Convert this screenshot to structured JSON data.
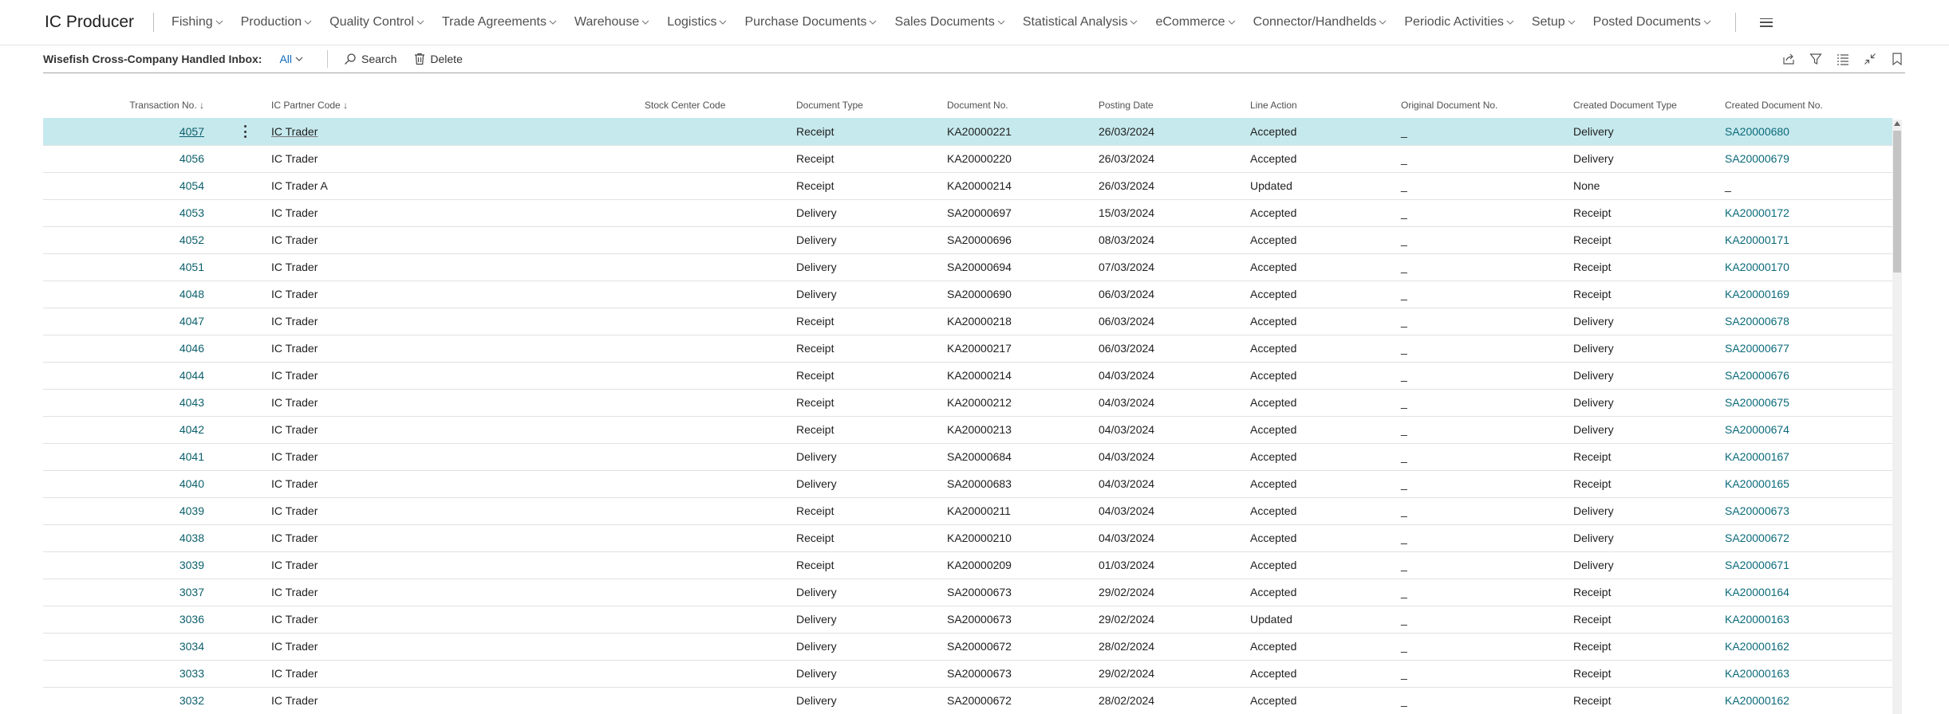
{
  "app_title": "IC Producer",
  "nav": [
    {
      "label": "Fishing"
    },
    {
      "label": "Production"
    },
    {
      "label": "Quality Control"
    },
    {
      "label": "Trade Agreements"
    },
    {
      "label": "Warehouse"
    },
    {
      "label": "Logistics"
    },
    {
      "label": "Purchase Documents"
    },
    {
      "label": "Sales Documents"
    },
    {
      "label": "Statistical Analysis"
    },
    {
      "label": "eCommerce"
    },
    {
      "label": "Connector/Handhelds"
    },
    {
      "label": "Periodic Activities"
    },
    {
      "label": "Setup"
    },
    {
      "label": "Posted Documents"
    }
  ],
  "page": {
    "caption": "Wisefish Cross-Company Handled Inbox:",
    "filter": "All",
    "actions": {
      "search": "Search",
      "delete": "Delete"
    }
  },
  "columns": [
    {
      "label": "Transaction No.",
      "sort": "↓"
    },
    {
      "label": "IC Partner Code",
      "sort": "↓"
    },
    {
      "label": "Stock Center Code"
    },
    {
      "label": "Document Type"
    },
    {
      "label": "Document No."
    },
    {
      "label": "Posting Date"
    },
    {
      "label": "Line Action"
    },
    {
      "label": "Original Document No."
    },
    {
      "label": "Created Document Type"
    },
    {
      "label": "Created Document No."
    }
  ],
  "rows": [
    {
      "tx": "4057",
      "partner": "IC Trader",
      "stock": "",
      "doctype": "Receipt",
      "docno": "KA20000221",
      "date": "26/03/2024",
      "action": "Accepted",
      "orig": "_",
      "ctype": "Delivery",
      "cno": "SA20000680"
    },
    {
      "tx": "4056",
      "partner": "IC Trader",
      "stock": "",
      "doctype": "Receipt",
      "docno": "KA20000220",
      "date": "26/03/2024",
      "action": "Accepted",
      "orig": "_",
      "ctype": "Delivery",
      "cno": "SA20000679"
    },
    {
      "tx": "4054",
      "partner": "IC Trader A",
      "stock": "",
      "doctype": "Receipt",
      "docno": "KA20000214",
      "date": "26/03/2024",
      "action": "Updated",
      "orig": "_",
      "ctype": "None",
      "cno": "_"
    },
    {
      "tx": "4053",
      "partner": "IC Trader",
      "stock": "",
      "doctype": "Delivery",
      "docno": "SA20000697",
      "date": "15/03/2024",
      "action": "Accepted",
      "orig": "_",
      "ctype": "Receipt",
      "cno": "KA20000172"
    },
    {
      "tx": "4052",
      "partner": "IC Trader",
      "stock": "",
      "doctype": "Delivery",
      "docno": "SA20000696",
      "date": "08/03/2024",
      "action": "Accepted",
      "orig": "_",
      "ctype": "Receipt",
      "cno": "KA20000171"
    },
    {
      "tx": "4051",
      "partner": "IC Trader",
      "stock": "",
      "doctype": "Delivery",
      "docno": "SA20000694",
      "date": "07/03/2024",
      "action": "Accepted",
      "orig": "_",
      "ctype": "Receipt",
      "cno": "KA20000170"
    },
    {
      "tx": "4048",
      "partner": "IC Trader",
      "stock": "",
      "doctype": "Delivery",
      "docno": "SA20000690",
      "date": "06/03/2024",
      "action": "Accepted",
      "orig": "_",
      "ctype": "Receipt",
      "cno": "KA20000169"
    },
    {
      "tx": "4047",
      "partner": "IC Trader",
      "stock": "",
      "doctype": "Receipt",
      "docno": "KA20000218",
      "date": "06/03/2024",
      "action": "Accepted",
      "orig": "_",
      "ctype": "Delivery",
      "cno": "SA20000678"
    },
    {
      "tx": "4046",
      "partner": "IC Trader",
      "stock": "",
      "doctype": "Receipt",
      "docno": "KA20000217",
      "date": "06/03/2024",
      "action": "Accepted",
      "orig": "_",
      "ctype": "Delivery",
      "cno": "SA20000677"
    },
    {
      "tx": "4044",
      "partner": "IC Trader",
      "stock": "",
      "doctype": "Receipt",
      "docno": "KA20000214",
      "date": "04/03/2024",
      "action": "Accepted",
      "orig": "_",
      "ctype": "Delivery",
      "cno": "SA20000676"
    },
    {
      "tx": "4043",
      "partner": "IC Trader",
      "stock": "",
      "doctype": "Receipt",
      "docno": "KA20000212",
      "date": "04/03/2024",
      "action": "Accepted",
      "orig": "_",
      "ctype": "Delivery",
      "cno": "SA20000675"
    },
    {
      "tx": "4042",
      "partner": "IC Trader",
      "stock": "",
      "doctype": "Receipt",
      "docno": "KA20000213",
      "date": "04/03/2024",
      "action": "Accepted",
      "orig": "_",
      "ctype": "Delivery",
      "cno": "SA20000674"
    },
    {
      "tx": "4041",
      "partner": "IC Trader",
      "stock": "",
      "doctype": "Delivery",
      "docno": "SA20000684",
      "date": "04/03/2024",
      "action": "Accepted",
      "orig": "_",
      "ctype": "Receipt",
      "cno": "KA20000167"
    },
    {
      "tx": "4040",
      "partner": "IC Trader",
      "stock": "",
      "doctype": "Delivery",
      "docno": "SA20000683",
      "date": "04/03/2024",
      "action": "Accepted",
      "orig": "_",
      "ctype": "Receipt",
      "cno": "KA20000165"
    },
    {
      "tx": "4039",
      "partner": "IC Trader",
      "stock": "",
      "doctype": "Receipt",
      "docno": "KA20000211",
      "date": "04/03/2024",
      "action": "Accepted",
      "orig": "_",
      "ctype": "Delivery",
      "cno": "SA20000673"
    },
    {
      "tx": "4038",
      "partner": "IC Trader",
      "stock": "",
      "doctype": "Receipt",
      "docno": "KA20000210",
      "date": "04/03/2024",
      "action": "Accepted",
      "orig": "_",
      "ctype": "Delivery",
      "cno": "SA20000672"
    },
    {
      "tx": "3039",
      "partner": "IC Trader",
      "stock": "",
      "doctype": "Receipt",
      "docno": "KA20000209",
      "date": "01/03/2024",
      "action": "Accepted",
      "orig": "_",
      "ctype": "Delivery",
      "cno": "SA20000671"
    },
    {
      "tx": "3037",
      "partner": "IC Trader",
      "stock": "",
      "doctype": "Delivery",
      "docno": "SA20000673",
      "date": "29/02/2024",
      "action": "Accepted",
      "orig": "_",
      "ctype": "Receipt",
      "cno": "KA20000164"
    },
    {
      "tx": "3036",
      "partner": "IC Trader",
      "stock": "",
      "doctype": "Delivery",
      "docno": "SA20000673",
      "date": "29/02/2024",
      "action": "Updated",
      "orig": "_",
      "ctype": "Receipt",
      "cno": "KA20000163"
    },
    {
      "tx": "3034",
      "partner": "IC Trader",
      "stock": "",
      "doctype": "Delivery",
      "docno": "SA20000672",
      "date": "28/02/2024",
      "action": "Accepted",
      "orig": "_",
      "ctype": "Receipt",
      "cno": "KA20000162"
    },
    {
      "tx": "3033",
      "partner": "IC Trader",
      "stock": "",
      "doctype": "Delivery",
      "docno": "SA20000673",
      "date": "29/02/2024",
      "action": "Accepted",
      "orig": "_",
      "ctype": "Receipt",
      "cno": "KA20000163"
    },
    {
      "tx": "3032",
      "partner": "IC Trader",
      "stock": "",
      "doctype": "Delivery",
      "docno": "SA20000672",
      "date": "28/02/2024",
      "action": "Accepted",
      "orig": "_",
      "ctype": "Receipt",
      "cno": "KA20000162"
    }
  ],
  "selected_row": 0,
  "icons": {
    "nav_chevron": "chevron-down-icon",
    "menu": "hamburger-menu-icon",
    "search": "search-icon",
    "delete": "trash-icon",
    "share": "share-icon",
    "filter": "filter-icon",
    "list": "list-view-icon",
    "collapse": "collapse-icon",
    "bookmark": "bookmark-icon",
    "row_menu": "more-options-icon"
  },
  "colors": {
    "accent": "#0f6cbd",
    "link": "#0b6a7a",
    "selected_row": "#c6e9ed"
  }
}
